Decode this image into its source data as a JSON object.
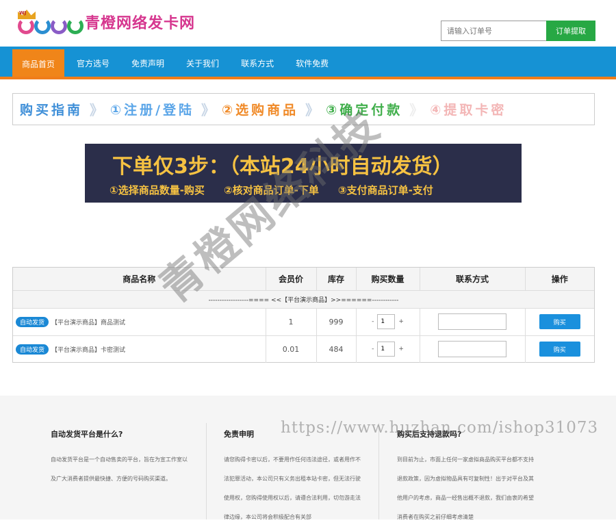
{
  "brand": {
    "logo_text": "WJ",
    "title": "青橙网络发卡网",
    "ring_colors": [
      "#e14a8e",
      "#2b8ed1",
      "#8a5cc6",
      "#2dae54"
    ]
  },
  "order_search": {
    "placeholder": "请输入订单号",
    "button": "订单提取"
  },
  "nav": {
    "items": [
      "商品首页",
      "官方选号",
      "免责声明",
      "关于我们",
      "联系方式",
      "软件免费"
    ],
    "active_index": 0
  },
  "guide": {
    "title": "购买指南",
    "arrow": "》",
    "steps": [
      {
        "label": "①注册/登陆",
        "color": "#5aa5e8"
      },
      {
        "label": "②选购商品",
        "color": "#f08a28"
      },
      {
        "label": "③确定付款",
        "color": "#3fae4a"
      },
      {
        "label": "④提取卡密",
        "color": "#f3b6b6"
      }
    ]
  },
  "banner": {
    "title": "下单仅3步：（本站24小时自动发货）",
    "steps": [
      "①选择商品数量-购买",
      "②核对商品订单-下单",
      "③支付商品订单-支付"
    ]
  },
  "watermark": "青橙网络科技",
  "table": {
    "headers": [
      "商品名称",
      "会员价",
      "库存",
      "购买数量",
      "联系方式",
      "操作"
    ],
    "category": "------------------==== <<【平台演示商品】>>======------------",
    "rows": [
      {
        "tag": "自动发货",
        "name": "【平台演示商品】商品测试",
        "price": "1",
        "stock": "999",
        "qty": "1",
        "buy": "购买"
      },
      {
        "tag": "自动发货",
        "name": "【平台演示商品】卡密测试",
        "price": "0.01",
        "stock": "484",
        "qty": "1",
        "buy": "购买"
      }
    ],
    "minus": "-",
    "plus": "+"
  },
  "footer": [
    {
      "title": "自动发货平台是什么?",
      "text": "自动发货平台是一个自动售卖的平台，旨在为宣工作室以及广大消费者提供最快捷、方便的号码购买渠道。"
    },
    {
      "title": "免责申明",
      "text": "请您购得卡密以后，不要用作任何违法途径，或者用作不法犯罪活动，本公司只有义务出租本站卡密，但无法行驶使用权，您购得使用权以后，请遵合法利用，切勿游走法律边缘，本公司将会积极配合有关部"
    },
    {
      "title": "购买后支持退款吗?",
      "text": "到目前为止，市面上任何一家虚拟商品购买平台都不支持退款政策，因为虚拟物品具有可复制性！出于对平台及其他用户的考虑，商品一经售出概不退款，我们由衷的希望消费者在购买之前仔细考虑清楚"
    }
  ],
  "url_watermark": "https://www.huzhan.com/ishop31073"
}
